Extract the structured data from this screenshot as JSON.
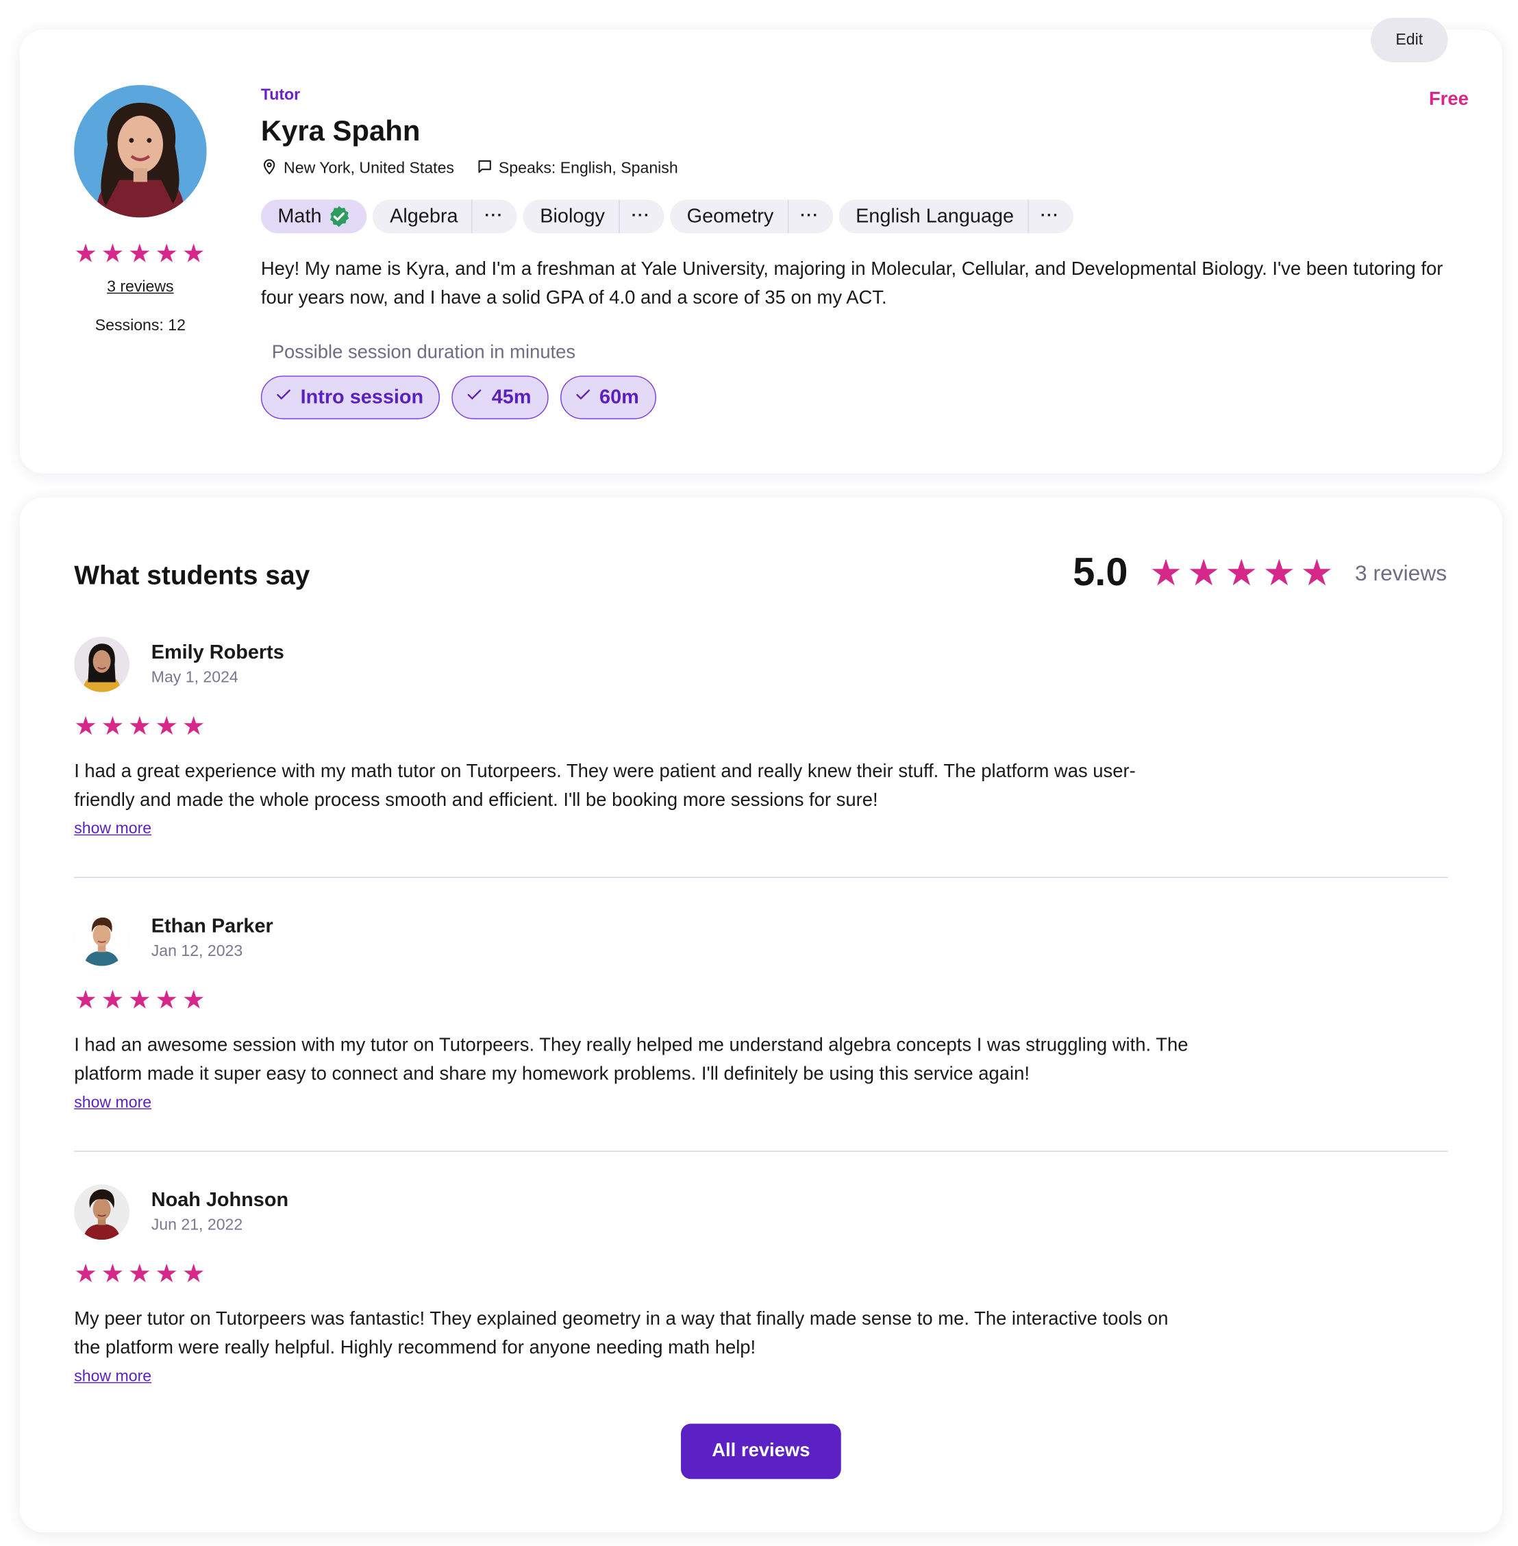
{
  "colors": {
    "accent_pink": "#d6288a",
    "accent_purple": "#5b21c4",
    "chip_bg": "#e3daf8",
    "verified_green": "#2e9b5f"
  },
  "profile": {
    "edit_label": "Edit",
    "price": "Free",
    "role": "Tutor",
    "name": "Kyra Spahn",
    "rating": 5,
    "reviews_link": "3 reviews",
    "sessions": "Sessions: 12",
    "location": "New York, United States",
    "languages": "Speaks: English, Spanish",
    "subjects": [
      {
        "label": "Math",
        "verified": true
      },
      {
        "label": "Algebra",
        "more": "···"
      },
      {
        "label": "Biology",
        "more": "···"
      },
      {
        "label": "Geometry",
        "more": "···"
      },
      {
        "label": "English Language",
        "more": "···"
      }
    ],
    "bio": "Hey! My name is Kyra, and I'm a freshman at Yale University, majoring in Molecular, Cellular, and Developmental Biology. I've been tutoring for four years now, and I have a solid GPA of 4.0 and a score of 35 on my ACT.",
    "duration_label": "Possible session duration in minutes",
    "durations": [
      "Intro session",
      "45m",
      "60m"
    ]
  },
  "reviews_section": {
    "title": "What students say",
    "average": "5.0",
    "count_label": "3 reviews",
    "all_reviews_label": "All reviews",
    "items": [
      {
        "name": "Emily Roberts",
        "date": "May 1, 2024",
        "rating": 5,
        "text": "I had a great experience with my math tutor on Tutorpeers. They were patient and really knew their stuff. The platform was user-friendly and made the whole process smooth and efficient. I'll be booking more sessions for sure!",
        "show_more": "show more"
      },
      {
        "name": "Ethan Parker",
        "date": "Jan 12, 2023",
        "rating": 5,
        "text": "I had an awesome session with my tutor on Tutorpeers. They really helped me understand algebra concepts I was struggling with. The platform made it super easy to connect and share my homework problems. I'll definitely be using this service again!",
        "show_more": "show more"
      },
      {
        "name": "Noah Johnson",
        "date": "Jun 21, 2022",
        "rating": 5,
        "text": "My peer tutor on Tutorpeers was fantastic! They explained geometry in a way that finally made sense to me. The interactive tools on the platform were really helpful. Highly recommend for anyone needing math help!",
        "show_more": "show more"
      }
    ]
  }
}
